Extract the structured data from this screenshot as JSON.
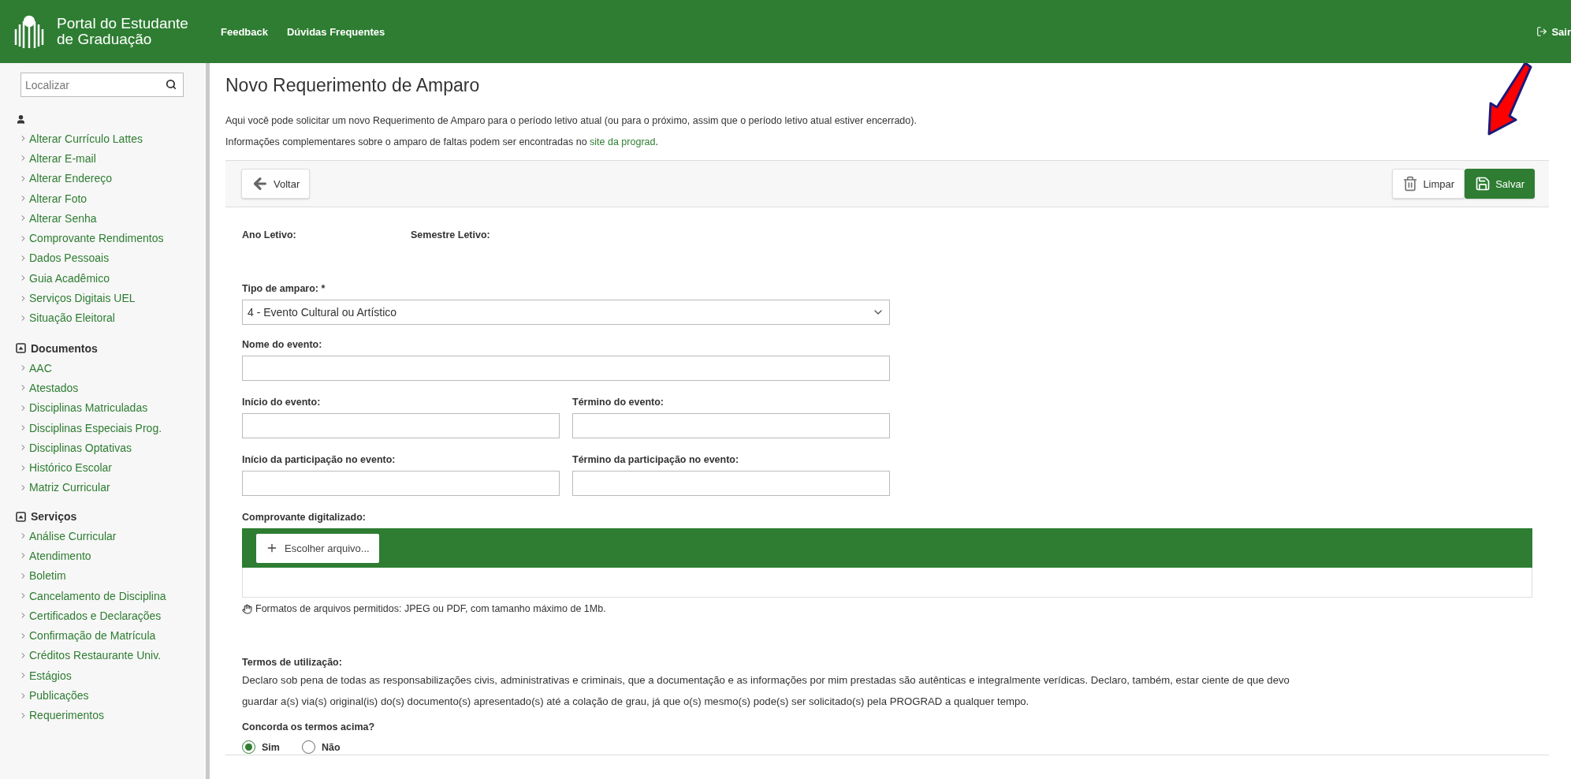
{
  "header": {
    "title_line1": "Portal do Estudante",
    "title_line2": "de Graduação",
    "nav": [
      "Feedback",
      "Dúvidas Frequentes"
    ],
    "logout": "Sair"
  },
  "sidebar": {
    "search": {
      "placeholder": "Localizar"
    },
    "sections": [
      {
        "kind": "user",
        "items": [
          "Alterar Currículo Lattes",
          "Alterar E-mail",
          "Alterar Endereço",
          "Alterar Foto",
          "Alterar Senha",
          "Comprovante Rendimentos",
          "Dados Pessoais",
          "Guia Acadêmico",
          "Serviços Digitais UEL",
          "Situação Eleitoral"
        ]
      },
      {
        "kind": "group",
        "title": "Documentos",
        "expanded": true,
        "items": [
          "AAC",
          "Atestados",
          "Disciplinas Matriculadas",
          "Disciplinas Especiais Prog.",
          "Disciplinas Optativas",
          "Histórico Escolar",
          "Matriz Curricular"
        ]
      },
      {
        "kind": "group",
        "title": "Serviços",
        "expanded": true,
        "items": [
          "Análise Curricular",
          "Atendimento",
          "Boletim",
          "Cancelamento de Disciplina",
          "Certificados e Declarações",
          "Confirmação de Matrícula",
          "Créditos Restaurante Univ.",
          "Estágios",
          "Publicações",
          "Requerimentos"
        ]
      }
    ]
  },
  "page": {
    "title": "Novo Requerimento de Amparo",
    "intro": "Aqui você pode solicitar um novo Requerimento de Amparo para o período letivo atual (ou para o próximo, assim que o período letivo atual estiver encerrado).",
    "info": "Informações complementares sobre o amparo de faltas podem ser encontradas no ",
    "info_link": "site da prograd",
    "info_end": ".",
    "toolbar": {
      "back": "Voltar",
      "clear": "Limpar",
      "save": "Salvar"
    },
    "period": [
      "Ano Letivo:",
      "Semestre Letivo:"
    ],
    "type_label": "Tipo de amparo:",
    "required_mark": "*",
    "type_value": "4 - Evento Cultural ou Artístico",
    "name_label": "Nome do evento:",
    "field_pairs": [
      [
        "Início do evento:",
        "Término do evento:"
      ],
      [
        "Início da participação no evento:",
        "Término da participação no evento:"
      ]
    ],
    "file_label": "Comprovante digitalizado:",
    "file_button": "Escolher arquivo...",
    "file_note": "Formatos de arquivos permitidos: JPEG ou PDF, com tamanho máximo de 1Mb.",
    "terms_title": "Termos de utilização:",
    "terms_text": "Declaro sob pena de todas as responsabilizações civis, administrativas e criminais, que a documentação e as informações por mim prestadas são autênticas e integralmente verídicas. Declaro, também, estar ciente de que devo guardar a(s) via(s) original(is) do(s) documento(s) apresentado(s) até a colação de grau, já que o(s) mesmo(s) pode(s) ser solicitado(s) pela PROGRAD a qualquer tempo.",
    "agree_label": "Concorda os termos acima?",
    "options": [
      {
        "label": "Sim",
        "selected": true
      },
      {
        "label": "Não",
        "selected": false
      }
    ]
  },
  "annotation": {
    "kind": "arrow"
  }
}
